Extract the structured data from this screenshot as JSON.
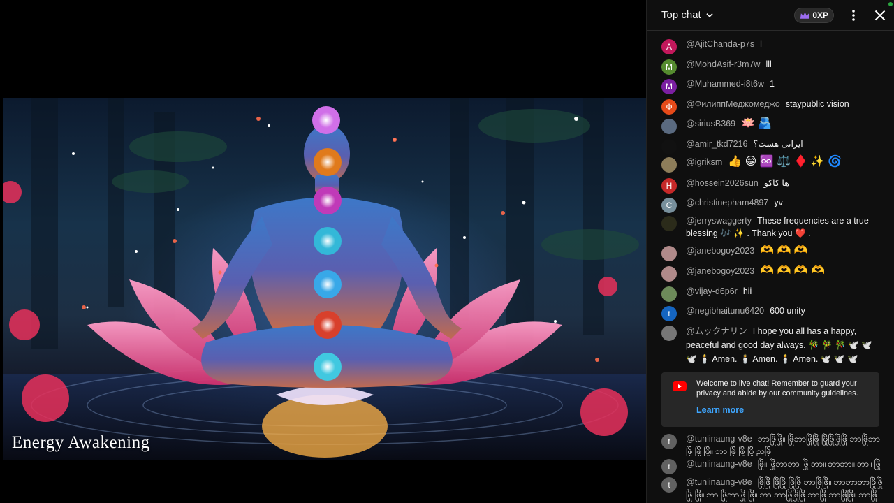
{
  "video": {
    "title_overlay": "Energy Awakening"
  },
  "chat": {
    "header": {
      "mode_label": "Top chat",
      "xp_label": "0XP"
    },
    "messages": [
      {
        "avatar_letter": "A",
        "avatar_color": "#c2185b",
        "author": "@AjitChanda-p7s",
        "text": "l"
      },
      {
        "avatar_letter": "M",
        "avatar_color": "#558b2f",
        "author": "@MohdAsif-r3m7w",
        "text": "lll"
      },
      {
        "avatar_letter": "M",
        "avatar_color": "#7b1fa2",
        "author": "@Muhammed-i8t6w",
        "text": "1"
      },
      {
        "avatar_letter": "Ф",
        "avatar_color": "#e64a19",
        "author": "@ФилиппМеджомеджо",
        "text": "staypublic vision"
      },
      {
        "avatar_letter": "",
        "avatar_color": "#5a6a80",
        "author": "@siriusB369",
        "text": "🪷 🫂"
      },
      {
        "avatar_letter": "",
        "avatar_color": "#111111",
        "author": "@amir_tkd7216",
        "text": "ایرانی هست؟"
      },
      {
        "avatar_letter": "",
        "avatar_color": "#8d7d5a",
        "author": "@igriksm",
        "text": "👍 😁 ♾️ ⚖️ ♦️ ✨ 🌀"
      },
      {
        "avatar_letter": "H",
        "avatar_color": "#c62828",
        "author": "@hossein2026sun",
        "text": "ها کاکو"
      },
      {
        "avatar_letter": "C",
        "avatar_color": "#78909c",
        "author": "@christinepham4897",
        "text": "yv"
      },
      {
        "avatar_letter": "",
        "avatar_color": "#2b2b1a",
        "author": "@jerryswaggerty",
        "text": "These frequencies are a true blessing 🎶 ✨ . Thank you ❤️ ."
      },
      {
        "avatar_letter": "",
        "avatar_color": "#b08a8a",
        "author": "@janebogoy2023",
        "text": "🫶 🫶 🫶"
      },
      {
        "avatar_letter": "",
        "avatar_color": "#b08a8a",
        "author": "@janebogoy2023",
        "text": "🫶 🫶 🫶 🫶"
      },
      {
        "avatar_letter": "",
        "avatar_color": "#6d8b5a",
        "author": "@vijay-d6p6r",
        "text": "hii"
      },
      {
        "avatar_letter": "t",
        "avatar_color": "#1565c0",
        "author": "@negibhaitunu6420",
        "text": "600 unity"
      },
      {
        "avatar_letter": "",
        "avatar_color": "#777777",
        "author": "@ムックナリン",
        "text": "I hope you all has a happy, peaceful and good day always. 🎋 🎋 🎋 🕊️ 🕊️ 🕊️ 🕯️ Amen. 🕯️ Amen. 🕯️ Amen. 🕊️ 🕊️ 🕊️"
      },
      {
        "avatar_letter": "t",
        "avatar_color": "#616161",
        "author": "@tunlinaung-v8e",
        "text": "ဘာဖြိုဖြို။ ဖြိုဘာဖြိုဖြို ဖြိုဖြိုဖြိုဖြို ဘာဖြိုဘာဖြို ဖြို ဖြို။ ဘာ ဖြို ဖြို ဖြို ညဖြို"
      },
      {
        "avatar_letter": "t",
        "avatar_color": "#616161",
        "author": "@tunlinaung-v8e",
        "text": "ဖြို။ ဖြိုဘာဘာ ဖြို ဘာ။ ဘာဘာ။ ဘာ။ ဖြို"
      },
      {
        "avatar_letter": "t",
        "avatar_color": "#616161",
        "author": "@tunlinaung-v8e",
        "text": "ဖြိုဖြို ဖြိုဖြို ဖြိုဖြို ဘာဖြိုဖြို။ ဘာဘာဘာဖြိုဖြိုဖြို ဖြို။ ဘာ ဖြိုဘာဖြို ဖြို။ ဘာ ဘာဖြိုဖြိုဖြို ဘာဖြို ဘာဖြိုဖြို။ ဘာဖြို ဘာ"
      }
    ],
    "welcome": {
      "text": "Welcome to live chat! Remember to guard your privacy and abide by our community guidelines.",
      "link_label": "Learn more"
    }
  }
}
